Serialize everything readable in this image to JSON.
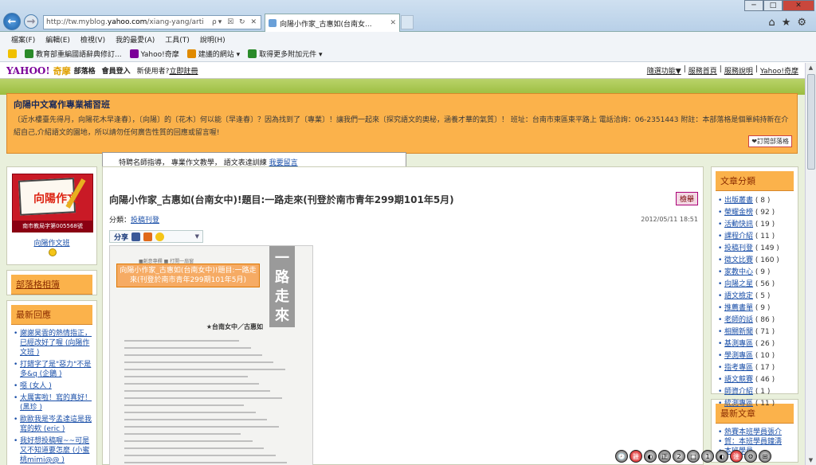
{
  "browser": {
    "url_prefix": "http://tw.myblog.",
    "url_host": "yahoo.com",
    "url_rest": "/xiang-yang/arti",
    "url_controls": "ρ▾ ☒ ↻ ✕",
    "tab_title": "向陽小作家_古惠如(台南女...",
    "tab_close": "✕",
    "new_tab_label": "",
    "window_min": "─",
    "window_max": "□",
    "window_close": "✕",
    "home_icon": "⌂",
    "star_icon": "★",
    "gear_icon": "⚙"
  },
  "menubar": [
    "檔案(F)",
    "編輯(E)",
    "檢視(V)",
    "我的最愛(A)",
    "工具(T)",
    "說明(H)"
  ],
  "favorites": [
    {
      "label": "",
      "icon": "favorites-star-icon",
      "color": "#f0c000"
    },
    {
      "label": "教育部重編國語辭典修訂...",
      "icon": "dictionary-icon",
      "color": "#2a8a2a"
    },
    {
      "label": "Yahoo!奇摩",
      "icon": "yahoo-icon",
      "color": "#7b0099"
    },
    {
      "label": "建議的網站 ▾",
      "icon": "suggested-sites-icon",
      "color": "#e08a00"
    },
    {
      "label": "取得更多附加元件 ▾",
      "icon": "addons-icon",
      "color": "#2a8a2a"
    }
  ],
  "yahoo": {
    "logo": "YAHOO!",
    "logo_sub": "奇摩",
    "blog": "部落格",
    "login": "會員登入",
    "new_user": "新使用者?",
    "register": "立即註冊",
    "right_links": [
      "隨選功能▼",
      "服務首頁",
      "服務說明",
      "Yahoo!奇摩"
    ],
    "sep": "|"
  },
  "banner": {
    "title": "向陽中文寫作專業補習班",
    "desc": "〔近水樓臺先得月，向陽花木早逢春〕，〔向陽〕的〔花木〕何以能〔早逢春〕？因為找到了〔專業〕！讓我們一起來〔探究語文的奧秘，涵養才華的氣質〕！ 班址：台南市東區東平路上 電話洽詢：06-2351443 附註：本部落格是個單純持新在介紹自己,介紹語文的園地，所以請勿任何廣告性質的回應或留言喔!",
    "subscribe": "❤訂閱部落格"
  },
  "featured": {
    "text": "特聘名師指導， 專業作文教學， 語文表達訓練 ",
    "link": "我要留言"
  },
  "profile": {
    "avatar_text": "向陽作文",
    "avatar_bottom": "南市教局字第005568號",
    "name": "向陽作文班"
  },
  "album": {
    "label": "部落格相簿"
  },
  "comments": {
    "title": "最新回應",
    "items": [
      {
        "text": "謝謝昊雲的熱情指正，已經改好了喔 ",
        "by": "(向陽作文班 )"
      },
      {
        "text": "打錯字了是\"惡力\"不是多&q ",
        "by": "(企鵝 )"
      },
      {
        "text": "噁 ",
        "by": "(女人 )"
      },
      {
        "text": "太厲害啦！寫的真好！ ",
        "by": "(黑珍 )"
      },
      {
        "text": "歐歐我是岑孟達這是我寫的欸 ",
        "by": "(eric )"
      },
      {
        "text": "我好想投稿喔~~可是又不知道要怎麼 ",
        "by": "(小蜜桃mimi@@ )"
      }
    ]
  },
  "post": {
    "title": "向陽小作家_古惠如(台南女中)!題目:一路走來(刊登於南市青年299期101年5月)",
    "report": "檢舉",
    "category_label": "分類：",
    "category": "投稿刊登",
    "date": "2012/05/11 18:51",
    "share": "分享",
    "scan_vertical": "一路走來",
    "scan_mini": "■創意專欄 ■ 打開一扇窗",
    "scan_overlay": "向陽小作家_古惠如(台南女中)!題目:一路走來(刊登於南市青年299期101年5月)",
    "scan_author": "★台南女中／古惠如"
  },
  "categories": {
    "title": "文章分類",
    "items": [
      {
        "name": "出版叢書",
        "count": "( 8 )"
      },
      {
        "name": "榮耀金榜",
        "count": "( 92 )"
      },
      {
        "name": "活動快訊",
        "count": "( 19 )"
      },
      {
        "name": "課程介紹",
        "count": "( 11 )"
      },
      {
        "name": "投稿刊登",
        "count": "( 149 )"
      },
      {
        "name": "徵文比賽",
        "count": "( 160 )"
      },
      {
        "name": "家教中心",
        "count": "( 9 )"
      },
      {
        "name": "向陽之星",
        "count": "( 56 )"
      },
      {
        "name": "語文檢定",
        "count": "( 5 )"
      },
      {
        "name": "推薦書單",
        "count": "( 9 )"
      },
      {
        "name": "老師的話",
        "count": "( 86 )"
      },
      {
        "name": "相關新聞",
        "count": "( 71 )"
      },
      {
        "name": "基測專區",
        "count": "( 26 )"
      },
      {
        "name": "學測專區",
        "count": "( 10 )"
      },
      {
        "name": "指考專區",
        "count": "( 17 )"
      },
      {
        "name": "語文競賽",
        "count": "( 46 )"
      },
      {
        "name": "師資介紹",
        "count": "( 1 )"
      },
      {
        "name": "統測專區",
        "count": "( 11 )"
      }
    ]
  },
  "newest": {
    "title": "最新文章",
    "items": [
      "熱賽本班學員張介",
      "賀：本班學員鐘濤 ",
      "本班學員"
    ]
  },
  "tray": [
    "🕗",
    "註",
    "◐",
    "正",
    "2",
    "□",
    "1",
    "◐",
    "注",
    "⚙",
    "⊞"
  ]
}
